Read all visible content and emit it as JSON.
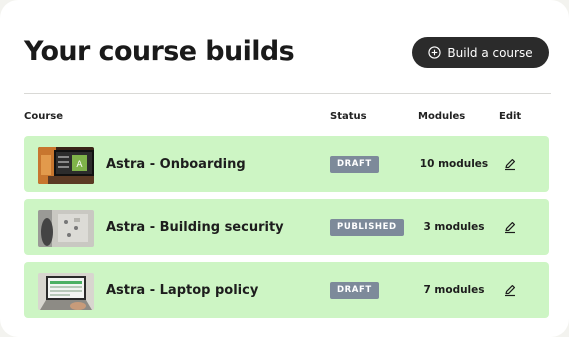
{
  "header": {
    "title": "Your course builds",
    "build_button_label": "Build a course"
  },
  "table": {
    "columns": {
      "course": "Course",
      "status": "Status",
      "modules": "Modules",
      "edit": "Edit"
    },
    "rows": [
      {
        "name": "Astra - Onboarding",
        "status": "DRAFT",
        "modules": "10 modules"
      },
      {
        "name": "Astra - Building security",
        "status": "PUBLISHED",
        "modules": "3 modules"
      },
      {
        "name": "Astra - Laptop policy",
        "status": "DRAFT",
        "modules": "7 modules"
      }
    ]
  },
  "icons": {
    "build_button": "plus-circle-icon",
    "edit": "pencil-icon"
  },
  "colors": {
    "row_background": "#cdf5c4",
    "status_badge": "#7d8a9a",
    "primary_button": "#2b2b2b"
  }
}
